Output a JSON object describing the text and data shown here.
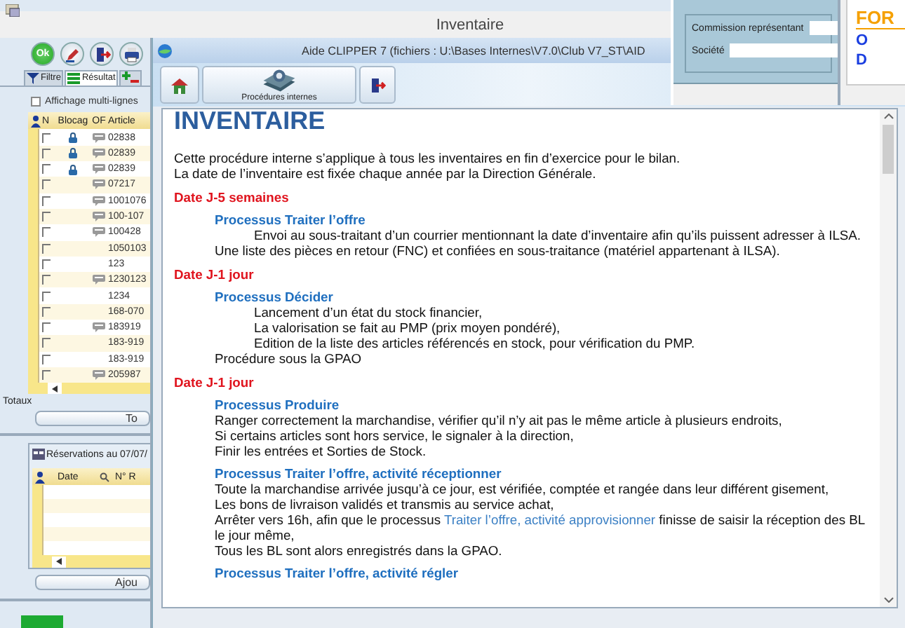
{
  "back_window": {
    "title": "Inventaire",
    "toolbar": [
      {
        "kind": "ok",
        "label": "Ok"
      },
      {
        "kind": "tool"
      },
      {
        "kind": "exit"
      },
      {
        "kind": "print"
      }
    ],
    "tabs": [
      {
        "kind": "filter",
        "label": "Filtre",
        "selected": false
      },
      {
        "kind": "list",
        "label": "Résultat",
        "selected": true
      },
      {
        "kind": "add",
        "selected": false
      }
    ],
    "multiline_checkbox": {
      "label": "Affichage multi-lignes",
      "checked": false
    },
    "grid": {
      "columns": [
        "N",
        "Blocag",
        "OF",
        "Article"
      ],
      "rows": [
        {
          "checked": false,
          "blocked": true,
          "comment": true,
          "article": "02838"
        },
        {
          "checked": false,
          "blocked": true,
          "comment": true,
          "article": "02839"
        },
        {
          "checked": false,
          "blocked": true,
          "comment": true,
          "article": "02839"
        },
        {
          "checked": false,
          "blocked": false,
          "comment": true,
          "article": "07217"
        },
        {
          "checked": false,
          "blocked": false,
          "comment": true,
          "article": "1001076"
        },
        {
          "checked": false,
          "blocked": false,
          "comment": true,
          "article": "100-107"
        },
        {
          "checked": false,
          "blocked": false,
          "comment": true,
          "article": "100428"
        },
        {
          "checked": false,
          "blocked": false,
          "comment": false,
          "article": "1050103"
        },
        {
          "checked": false,
          "blocked": false,
          "comment": false,
          "article": "123"
        },
        {
          "checked": false,
          "blocked": false,
          "comment": true,
          "article": "1230123"
        },
        {
          "checked": false,
          "blocked": false,
          "comment": false,
          "article": "1234"
        },
        {
          "checked": false,
          "blocked": false,
          "comment": false,
          "article": "168-070"
        },
        {
          "checked": false,
          "blocked": false,
          "comment": true,
          "article": "183919"
        },
        {
          "checked": false,
          "blocked": false,
          "comment": false,
          "article": "183-919"
        },
        {
          "checked": false,
          "blocked": false,
          "comment": false,
          "article": "183-919"
        },
        {
          "checked": false,
          "blocked": false,
          "comment": true,
          "article": "205987"
        }
      ]
    },
    "totals_label": "Totaux",
    "totals_button": "To",
    "reservations": {
      "title": "Réservations au 07/07/",
      "columns": [
        "Date",
        "N° R"
      ],
      "button": "Ajou"
    }
  },
  "form_window": {
    "fields": [
      {
        "label": "Commission représentant"
      },
      {
        "label": "Société"
      }
    ]
  },
  "far_window": {
    "heading": "FOR",
    "lines": [
      "O",
      "D"
    ]
  },
  "help_window": {
    "title": "Aide CLIPPER 7 (fichiers : U:\\Bases Internes\\V7.0\\Club V7_ST\\AID",
    "toolbar": [
      {
        "kind": "home"
      },
      {
        "kind": "book",
        "label": "Procédures internes"
      },
      {
        "kind": "exit"
      }
    ],
    "heading": "INVENTAIRE",
    "blocks": [
      {
        "kind": "text",
        "text": "Cette procédure interne s’applique à tous les inventaires en fin d’exercice pour le bilan."
      },
      {
        "kind": "text",
        "text": "La date de l’inventaire est fixée chaque année par la Direction Générale."
      },
      {
        "kind": "date",
        "text": "Date J-5 semaines"
      },
      {
        "kind": "process",
        "text": "Processus Traiter l’offre"
      },
      {
        "kind": "indented",
        "text": "Envoi au sous-traitant d’un courrier mentionnant la date d’inventaire afin qu’ils puissent adresser à ILSA."
      },
      {
        "kind": "line",
        "text": "Une liste des pièces en retour (FNC) et confiées en sous-traitance (matériel appartenant à ILSA)."
      },
      {
        "kind": "date",
        "text": "Date J-1 jour"
      },
      {
        "kind": "process",
        "text": "Processus Décider"
      },
      {
        "kind": "indented",
        "text": "Lancement d’un état du stock financier,"
      },
      {
        "kind": "indented",
        "text": "La valorisation se fait au PMP (prix moyen pondéré),"
      },
      {
        "kind": "indented",
        "text": "Edition de la liste des articles référencés en stock, pour vérification du PMP."
      },
      {
        "kind": "line",
        "text": "Procédure sous la GPAO"
      },
      {
        "kind": "date",
        "text": "Date J-1 jour"
      },
      {
        "kind": "process",
        "text": "Processus Produire"
      },
      {
        "kind": "line",
        "text": "Ranger correctement la marchandise, vérifier qu’il n’y ait pas le même article à plusieurs endroits,"
      },
      {
        "kind": "line",
        "text": "Si certains articles sont hors service, le signaler à la direction,"
      },
      {
        "kind": "line",
        "text": "Finir les entrées et Sorties de Stock."
      },
      {
        "kind": "process",
        "text": "Processus Traiter l’offre, activité réceptionner"
      },
      {
        "kind": "line",
        "text": "Toute la marchandise arrivée jusqu’à ce jour, est vérifiée, comptée et rangée dans leur différent gisement,"
      },
      {
        "kind": "line",
        "text": "Les bons de livraison validés et transmis au service achat,"
      },
      {
        "kind": "link_line",
        "before": "Arrêter vers 16h, afin que le processus",
        "link": "Traiter l’offre, activité approvisionner",
        "after": "finisse de saisir la réception des BL le jour même,"
      },
      {
        "kind": "line",
        "text": "Tous les BL sont alors enregistrés dans la GPAO."
      },
      {
        "kind": "process",
        "text": "Processus Traiter l’offre, activité régler"
      }
    ]
  }
}
